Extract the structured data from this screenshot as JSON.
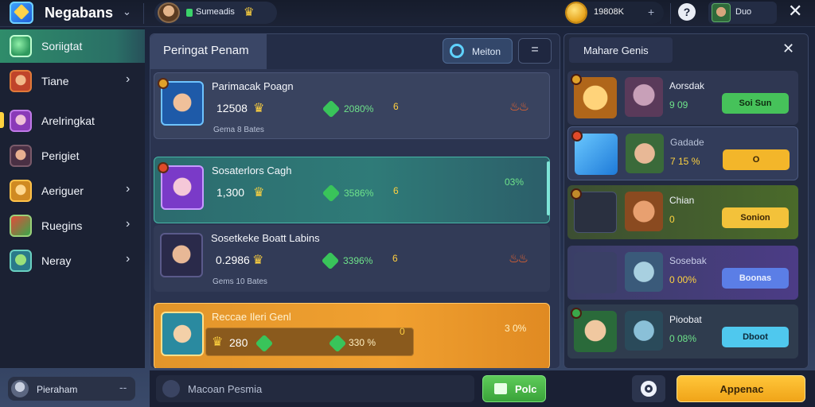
{
  "app": {
    "title": "Negabans"
  },
  "player": {
    "name": "Sumeadis"
  },
  "currency": {
    "coins": "19808K",
    "plus": "+"
  },
  "profile": {
    "name": "Duo"
  },
  "sidebar": {
    "items": [
      {
        "label": "Soriigtat",
        "active": true,
        "chevron": false,
        "icon": "globe-icon"
      },
      {
        "label": "Tiane",
        "active": false,
        "chevron": true,
        "icon": "warrior-icon"
      },
      {
        "label": "Arelringkat",
        "active": false,
        "chevron": false,
        "icon": "mage-icon"
      },
      {
        "label": "Perigiet",
        "active": false,
        "chevron": false,
        "icon": "rogue-icon"
      },
      {
        "label": "Aeriguer",
        "active": false,
        "chevron": true,
        "icon": "lion-icon"
      },
      {
        "label": "Ruegins",
        "active": false,
        "chevron": true,
        "icon": "scroll-icon"
      },
      {
        "label": "Neray",
        "active": false,
        "chevron": true,
        "icon": "goblin-icon"
      }
    ],
    "footer": {
      "label": "Pieraham",
      "dash": "--"
    }
  },
  "main": {
    "tab": "Peringat Penam",
    "filter_label": "Meiton",
    "menu_label": "=",
    "rows": [
      {
        "title": "Parimacak Poagn",
        "amount": "12508",
        "stat": "2080%",
        "mini": "6",
        "sub": "Gema 8  Bates",
        "right": "flames"
      },
      {
        "title": "Sosaterlors Cagh",
        "amount": "1,300",
        "stat": "3586%",
        "mini": "6",
        "sub": "",
        "right": "03%"
      },
      {
        "title": "Sosetkeke Boatt Labins",
        "amount": "0.2986",
        "stat": "3396%",
        "mini": "6",
        "sub": "Gems 10  Bates",
        "right": "flames"
      },
      {
        "title": "Reccae Ileri Genl",
        "amount": "280",
        "stat": "330 %",
        "mini": "0",
        "sub": "",
        "right": "3 0%"
      }
    ]
  },
  "right": {
    "title": "Mahare Genis",
    "cards": [
      {
        "name": "Aorsdak",
        "value": "9 09",
        "button": "Soi Sun",
        "btn_color": "#46c25a",
        "btn_text": "#0e2a10"
      },
      {
        "name": "Gadade",
        "value": "7 15 %",
        "button": "O",
        "btn_color": "#f3b62a",
        "btn_text": "#3a2608"
      },
      {
        "name": "Chian",
        "value": "0",
        "button": "Sonion",
        "btn_color": "#f3c23a",
        "btn_text": "#3a2608"
      },
      {
        "name": "Sosebak",
        "value": "0 00%",
        "button": "Boonas",
        "btn_color": "#5b7ee6",
        "btn_text": "#eaf0ff"
      },
      {
        "name": "Pioobat",
        "value": "0 08%",
        "button": "Dboot",
        "btn_color": "#4fc8ee",
        "btn_text": "#0e2a3a"
      }
    ]
  },
  "bottom": {
    "chat_placeholder": "Macoan Pesmia",
    "play_label": "Polc",
    "approve_label": "Appenac"
  }
}
